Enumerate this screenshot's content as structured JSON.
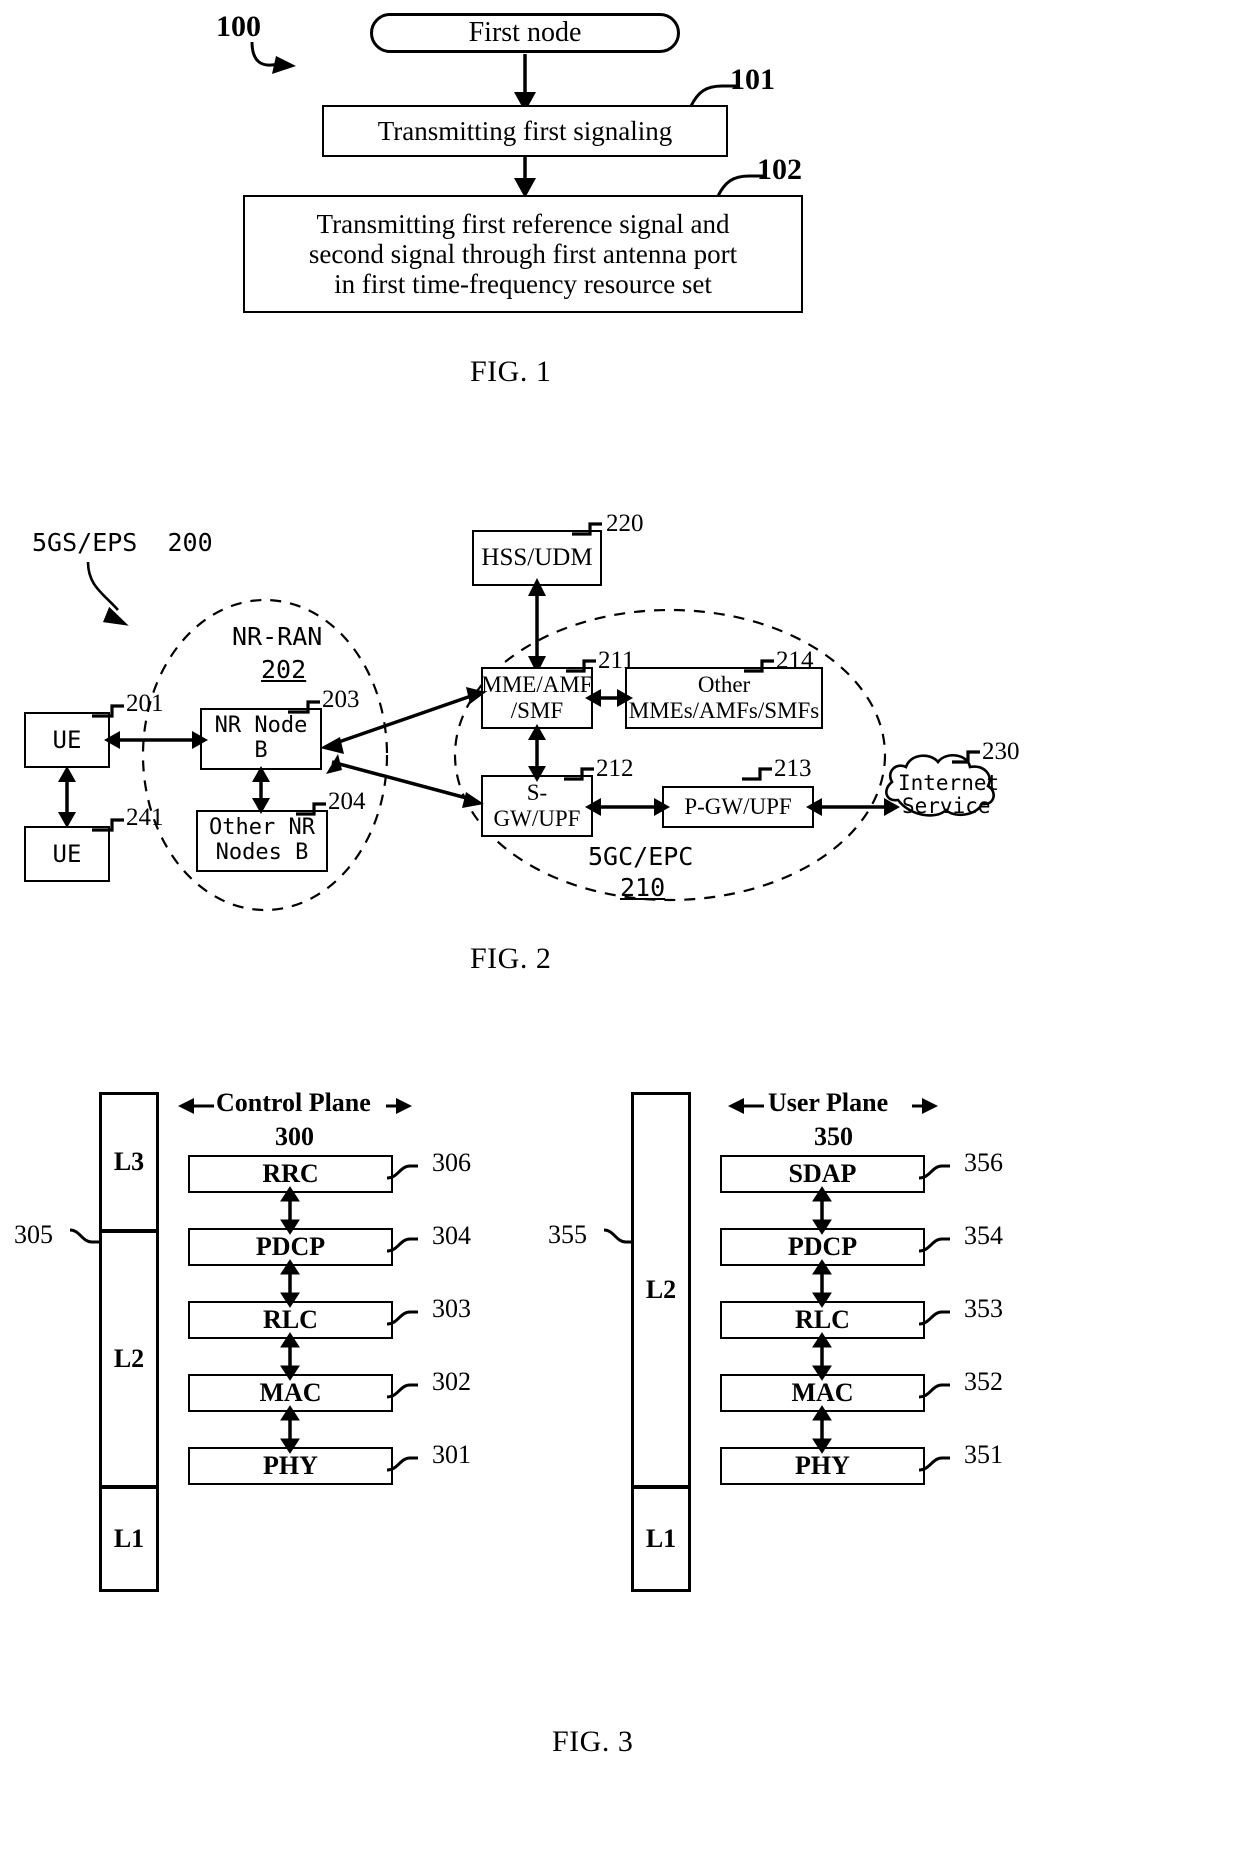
{
  "figures": [
    {
      "id": "fig1",
      "caption": "FIG. 1",
      "diagram_ref": "100",
      "nodes": [
        {
          "id": "start",
          "label": "First node",
          "ref": ""
        },
        {
          "id": "step101",
          "label": "Transmitting first signaling",
          "ref": "101"
        },
        {
          "id": "step102",
          "label": "Transmitting first reference signal and second signal through first antenna port in first time-frequency resource set",
          "ref": "102",
          "lines": [
            "Transmitting first reference signal and",
            "second signal through first antenna port",
            "in first time-frequency resource set"
          ]
        }
      ]
    },
    {
      "id": "fig2",
      "caption": "FIG. 2",
      "system_label": "5GS/EPS  200",
      "ran_label": "NR-RAN",
      "ran_ref": "202",
      "core_label": "5GC/EPC",
      "core_ref": "210",
      "nodes": [
        {
          "id": "ue1",
          "label": "UE",
          "ref": "201"
        },
        {
          "id": "ue2",
          "label": "UE",
          "ref": "241"
        },
        {
          "id": "nrnode",
          "label": "NR Node B",
          "lines": [
            "NR Node",
            "B"
          ],
          "ref": "203"
        },
        {
          "id": "othernr",
          "label": "Other NR Nodes B",
          "lines": [
            "Other NR",
            "Nodes B"
          ],
          "ref": "204"
        },
        {
          "id": "hss",
          "label": "HSS/UDM",
          "ref": "220"
        },
        {
          "id": "mme",
          "label": "MME/AMF /SMF",
          "lines": [
            "MME/AMF",
            "/SMF"
          ],
          "ref": "211"
        },
        {
          "id": "othermme",
          "label": "Other MMEs/AMFs/SMFs",
          "lines": [
            "Other",
            "MMEs/AMFs/SMFs"
          ],
          "ref": "214"
        },
        {
          "id": "sgw",
          "label": "S- GW/UPF",
          "lines": [
            "S-",
            "GW/UPF"
          ],
          "ref": "212"
        },
        {
          "id": "pgw",
          "label": "P-GW/UPF",
          "ref": "213"
        },
        {
          "id": "internet",
          "label": "Internet Service",
          "lines": [
            "Internet",
            "Service"
          ],
          "ref": "230"
        }
      ]
    },
    {
      "id": "fig3",
      "caption": "FIG. 3",
      "control_plane": {
        "title": "Control Plane",
        "ref": "300",
        "stack_ref": "305",
        "layers": [
          {
            "name": "L3",
            "protocols": [
              {
                "label": "RRC",
                "ref": "306"
              }
            ]
          },
          {
            "name": "L2",
            "protocols": [
              {
                "label": "PDCP",
                "ref": "304"
              },
              {
                "label": "RLC",
                "ref": "303"
              },
              {
                "label": "MAC",
                "ref": "302"
              }
            ]
          },
          {
            "name": "L1",
            "protocols": [
              {
                "label": "PHY",
                "ref": "301"
              }
            ]
          }
        ]
      },
      "user_plane": {
        "title": "User Plane",
        "ref": "350",
        "stack_ref": "355",
        "layers": [
          {
            "name": "L2",
            "protocols": [
              {
                "label": "SDAP",
                "ref": "356"
              },
              {
                "label": "PDCP",
                "ref": "354"
              },
              {
                "label": "RLC",
                "ref": "353"
              },
              {
                "label": "MAC",
                "ref": "352"
              }
            ]
          },
          {
            "name": "L1",
            "protocols": [
              {
                "label": "PHY",
                "ref": "351"
              }
            ]
          }
        ]
      }
    }
  ]
}
